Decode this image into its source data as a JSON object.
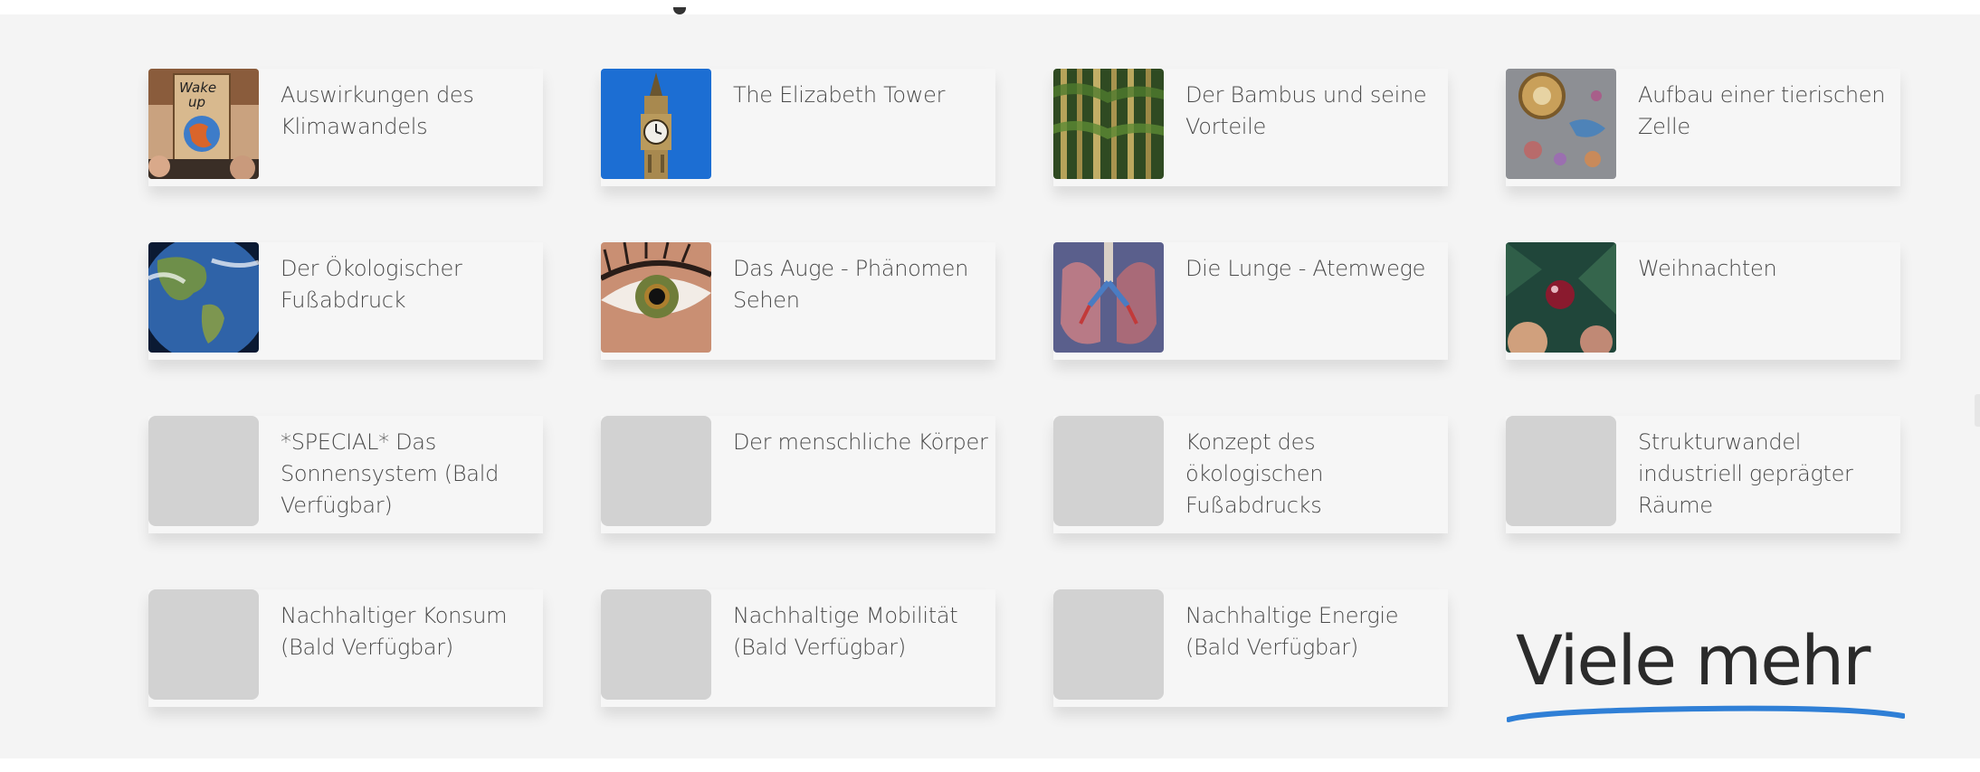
{
  "topics": [
    {
      "title": "Auswirkungen des Klimawandels",
      "image": "protest-sign-wake-up"
    },
    {
      "title": "The Elizabeth Tower",
      "image": "clock-tower"
    },
    {
      "title": "Der Bambus und seine Vorteile",
      "image": "bamboo"
    },
    {
      "title": "Aufbau einer tierischen Zelle",
      "image": "animal-cell"
    },
    {
      "title": "Der Ökologischer Fußabdruck",
      "image": "earth"
    },
    {
      "title": "Das Auge - Phänomen Sehen",
      "image": "eye"
    },
    {
      "title": "Die Lunge - Atemwege",
      "image": "lungs"
    },
    {
      "title": "Weihnachten",
      "image": "christmas-ornament"
    },
    {
      "title": "*SPECIAL* Das Sonnensystem (Bald Verfügbar)",
      "image": "placeholder"
    },
    {
      "title": "Der menschliche Körper",
      "image": "placeholder"
    },
    {
      "title": "Konzept des ökologischen Fußabdrucks",
      "image": "placeholder"
    },
    {
      "title": "Strukturwandel industriell geprägter Räume",
      "image": "placeholder"
    },
    {
      "title": "Nachhaltiger Konsum (Bald Verfügbar)",
      "image": "placeholder"
    },
    {
      "title": "Nachhaltige Mobilität (Bald Verfügbar)",
      "image": "placeholder"
    },
    {
      "title": "Nachhaltige Energie (Bald Verfügbar)",
      "image": "placeholder"
    }
  ],
  "more_link": {
    "label": "Viele mehr",
    "underline_color": "#2f7fd6"
  },
  "colors": {
    "background": "#f4f4f4",
    "card": "#f6f6f6",
    "placeholder": "#d2d2d2",
    "text": "#4a4a4a"
  }
}
